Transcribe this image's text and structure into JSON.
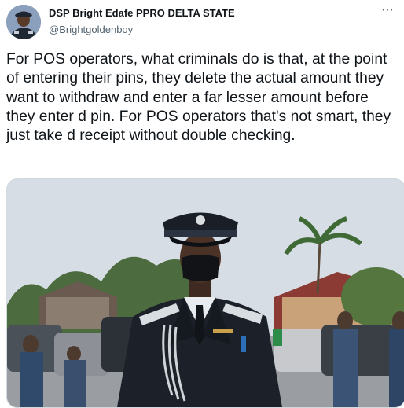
{
  "tweet": {
    "author_name": "DSP Bright Edafe PPRO DELTA STATE",
    "author_handle": "@Brightgoldenboy",
    "more_label": "···",
    "text": "For POS operators, what criminals do is that, at the point of entering their pins, they delete the actual amount they want to withdraw and enter a far lesser amount before they enter d pin. For POS operators that's not smart, they just take d receipt without double checking."
  },
  "icons": {
    "more": "more-horizontal-icon"
  },
  "colors": {
    "text": "#0f1419",
    "secondary": "#536471",
    "border": "#cfd9de",
    "uniform": "#1c2129"
  }
}
